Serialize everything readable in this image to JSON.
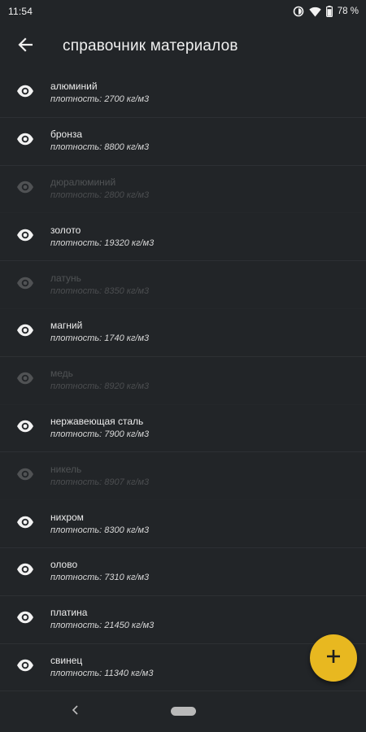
{
  "status_bar": {
    "time": "11:54",
    "battery": "78 %",
    "icons": [
      "data-saver-icon",
      "wifi-icon",
      "battery-icon"
    ]
  },
  "toolbar": {
    "back_icon": "arrow-back-icon",
    "title": "справочник материалов"
  },
  "materials": [
    {
      "name": "алюминий",
      "density": "плотность: 2700 кг/м3",
      "visible": true
    },
    {
      "name": "бронза",
      "density": "плотность: 8800 кг/м3",
      "visible": true
    },
    {
      "name": "дюралюминий",
      "density": "плотность: 2800 кг/м3",
      "visible": false
    },
    {
      "name": "золото",
      "density": "плотность: 19320 кг/м3",
      "visible": true
    },
    {
      "name": "латунь",
      "density": "плотность: 8350 кг/м3",
      "visible": false
    },
    {
      "name": "магний",
      "density": "плотность: 1740 кг/м3",
      "visible": true
    },
    {
      "name": "медь",
      "density": "плотность: 8920 кг/м3",
      "visible": false
    },
    {
      "name": "нержавеющая сталь",
      "density": "плотность: 7900 кг/м3",
      "visible": true
    },
    {
      "name": "никель",
      "density": "плотность: 8907 кг/м3",
      "visible": false
    },
    {
      "name": "нихром",
      "density": "плотность: 8300 кг/м3",
      "visible": true
    },
    {
      "name": "олово",
      "density": "плотность: 7310 кг/м3",
      "visible": true
    },
    {
      "name": "платина",
      "density": "плотность: 21450 кг/м3",
      "visible": true
    },
    {
      "name": "свинец",
      "density": "плотность: 11340 кг/м3",
      "visible": true
    }
  ],
  "fab": {
    "label": "+",
    "color": "#e8b820"
  },
  "colors": {
    "background": "#222528",
    "accent": "#e8b820",
    "divider": "#2d3034"
  }
}
